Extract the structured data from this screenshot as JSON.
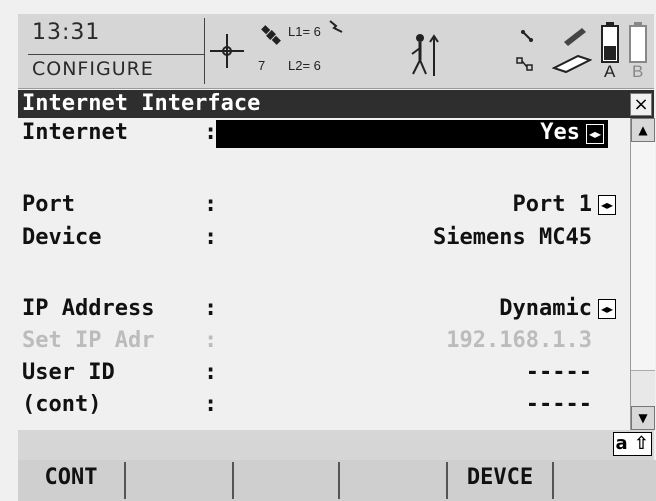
{
  "status": {
    "time": "13:31",
    "mode": "CONFIGURE",
    "l1": "L1= 6",
    "l2": "L2= 6",
    "sat_count": "7",
    "battery_a": "A",
    "battery_b": "B"
  },
  "window": {
    "title": "Internet Interface",
    "close_label": "×"
  },
  "form": {
    "internet": {
      "label": "Internet",
      "value": "Yes"
    },
    "port": {
      "label": "Port",
      "value": "Port 1"
    },
    "device": {
      "label": "Device",
      "value": "Siemens MC45"
    },
    "ip_address": {
      "label": "IP Address",
      "value": "Dynamic"
    },
    "set_ip": {
      "label": "Set IP Adr",
      "value": "192.168.1.3"
    },
    "user_id": {
      "label": "User ID",
      "value": "-----"
    },
    "cont": {
      "label": "(cont)",
      "value": "-----"
    }
  },
  "footer": {
    "caps_indicator": "a ⇧",
    "keys": [
      "CONT",
      "",
      "",
      "",
      "DEVCE",
      ""
    ]
  },
  "colors": {
    "title_bg": "#2e2e2e",
    "selected_bg": "#000000",
    "disabled_text": "#bcbcbc"
  }
}
